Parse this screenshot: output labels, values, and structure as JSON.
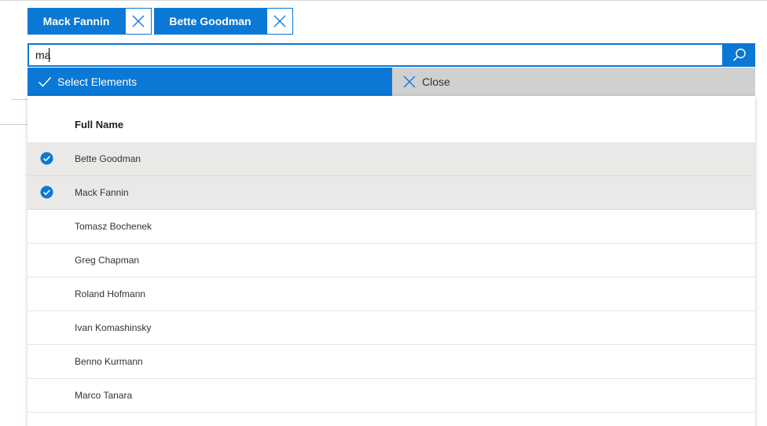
{
  "selected_chips": [
    {
      "label": "Mack Fannin"
    },
    {
      "label": "Bette Goodman"
    }
  ],
  "search": {
    "value": "ma",
    "button_icon": "search-icon"
  },
  "actions": {
    "select_label": "Select Elements",
    "close_label": "Close"
  },
  "table": {
    "column_header": "Full Name",
    "rows": [
      {
        "name": "Bette Goodman",
        "selected": true
      },
      {
        "name": "Mack Fannin",
        "selected": true
      },
      {
        "name": "Tomasz Bochenek",
        "selected": false
      },
      {
        "name": "Greg Chapman",
        "selected": false
      },
      {
        "name": "Roland Hofmann",
        "selected": false
      },
      {
        "name": "Ivan Komashinsky",
        "selected": false
      },
      {
        "name": "Benno Kurmann",
        "selected": false
      },
      {
        "name": "Marco Tanara",
        "selected": false
      },
      {
        "name": "",
        "selected": false
      }
    ]
  },
  "colors": {
    "accent": "#0a78d4",
    "close_bg": "#d0d0d0",
    "selected_row": "#ebe9e7"
  }
}
